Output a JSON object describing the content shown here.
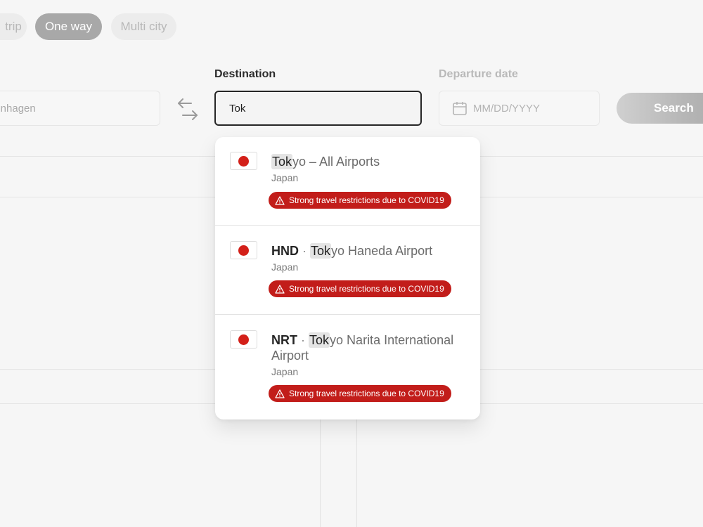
{
  "trip_types": {
    "round_trip": "trip",
    "one_way": "One way",
    "multi_city": "Multi city"
  },
  "origin": {
    "value": "penhagen"
  },
  "destination": {
    "label": "Destination",
    "value": "Tok"
  },
  "departure": {
    "label": "Departure date",
    "placeholder": "MM/DD/YYYY"
  },
  "search": {
    "label": "Search"
  },
  "suggestions": [
    {
      "code": "",
      "match": "Tok",
      "rest": "yo – All Airports",
      "country": "Japan",
      "warning": "Strong travel restrictions due to COVID19"
    },
    {
      "code": "HND",
      "separator": "·",
      "match": "Tok",
      "rest": "yo Haneda Airport",
      "country": "Japan",
      "warning": "Strong travel restrictions due to COVID19"
    },
    {
      "code": "NRT",
      "separator": "·",
      "match": "Tok",
      "rest": "yo Narita International Airport",
      "country": "Japan",
      "warning": "Strong travel restrictions due to COVID19"
    }
  ],
  "colors": {
    "warning_bg": "#c21d1a",
    "flag_sun": "#d32019",
    "active_pill": "#a8a8a8"
  },
  "icons": [
    "swap-arrows-icon",
    "calendar-icon",
    "warning-triangle-icon",
    "japan-flag-icon"
  ]
}
